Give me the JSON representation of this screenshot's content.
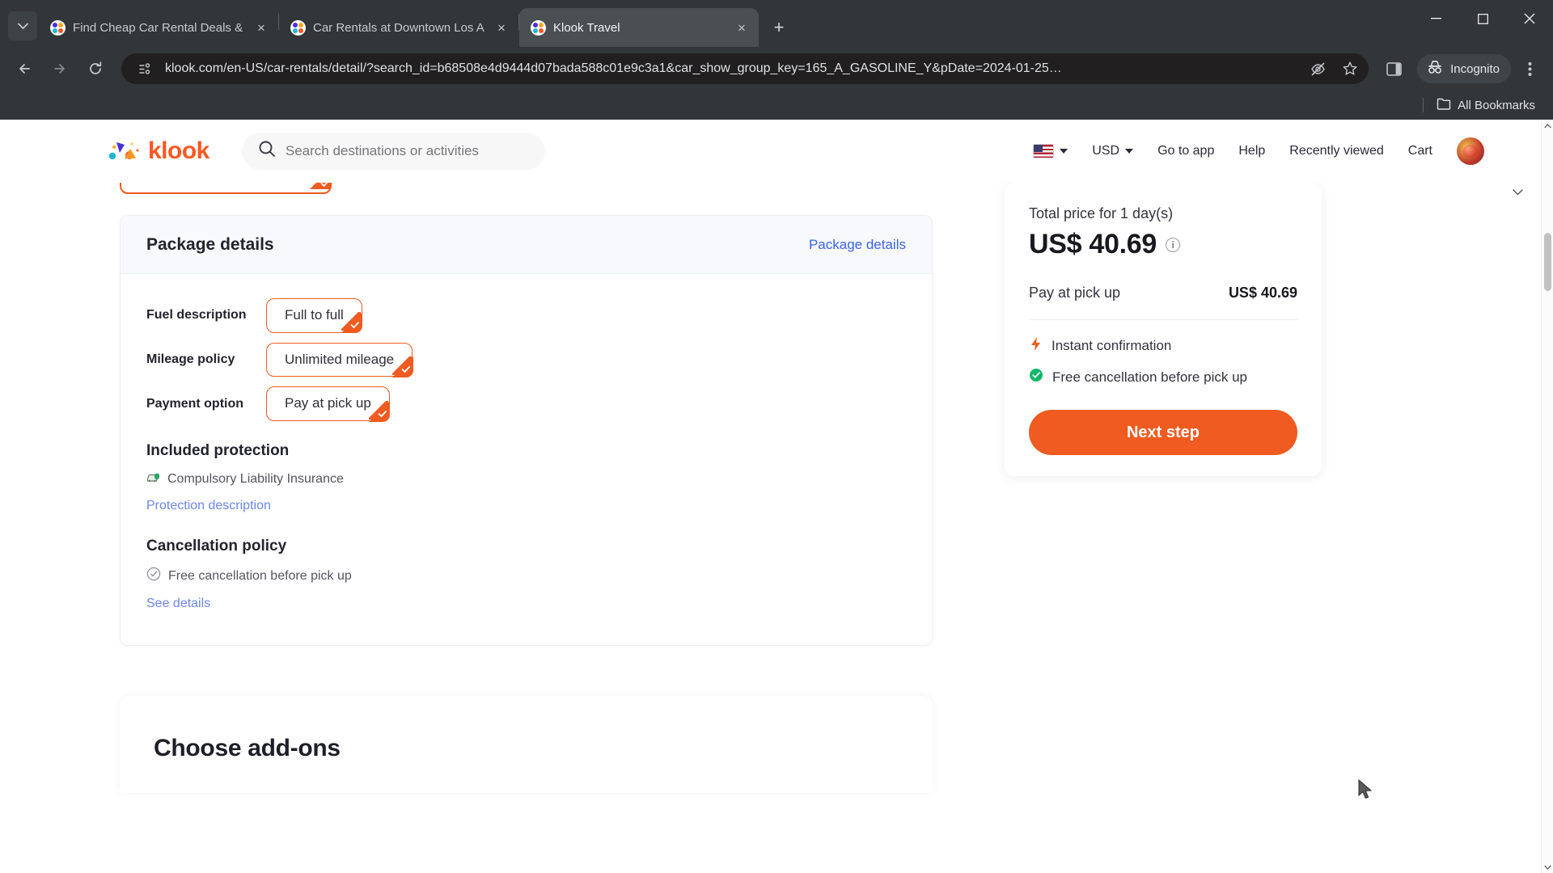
{
  "browser": {
    "tabs": [
      {
        "title": "Find Cheap Car Rental Deals &",
        "favicon": "klook-favicon",
        "active": false
      },
      {
        "title": "Car Rentals at Downtown Los A",
        "favicon": "klook-favicon",
        "active": false
      },
      {
        "title": "Klook Travel",
        "favicon": "klook-favicon",
        "active": true
      }
    ],
    "tab_close_label": "×",
    "new_tab_label": "+",
    "tab_search_icon": "chevron-down-icon",
    "window": {
      "minimize": "−",
      "maximize": "□",
      "close": "✕"
    },
    "nav": {
      "back": "←",
      "forward": "→",
      "reload": "⟳"
    },
    "omnibox": {
      "site_info_icon": "site-settings-icon",
      "url": "klook.com/en-US/car-rentals/detail/?search_id=b68508e4d9444d07bada588c01e9c3a1&car_show_group_key=165_A_GASOLINE_Y&pDate=2024-01-25…",
      "tracking_icon": "eye-slash-icon",
      "bookmark_icon": "star-icon"
    },
    "side_panel_icon": "side-panel-icon",
    "incognito_label": "Incognito",
    "incognito_icon": "incognito-hat-icon",
    "menu_icon": "three-dot-menu-icon",
    "bookmarks": {
      "label": "All Bookmarks",
      "icon": "folder-icon"
    }
  },
  "site": {
    "header": {
      "logo_text": "klook",
      "search_placeholder": "Search destinations or activities",
      "search_icon": "search-icon",
      "language": {
        "flag": "us-flag-icon",
        "caret": "chevron-down-icon"
      },
      "currency": "USD",
      "nav_items": [
        "Go to app",
        "Help",
        "Recently viewed",
        "Cart"
      ],
      "avatar": "user-avatar"
    },
    "package_card": {
      "title": "Package details",
      "details_link": "Package details",
      "options": [
        {
          "label": "Fuel description",
          "value": "Full to full",
          "selected": true
        },
        {
          "label": "Mileage policy",
          "value": "Unlimited mileage",
          "selected": true
        },
        {
          "label": "Payment option",
          "value": "Pay at pick up",
          "selected": true
        }
      ],
      "protection": {
        "title": "Included protection",
        "item": "Compulsory Liability Insurance",
        "item_icon": "car-shield-icon",
        "link": "Protection description"
      },
      "cancellation": {
        "title": "Cancellation policy",
        "item": "Free cancellation before pick up",
        "item_icon": "check-circle-outline-icon",
        "link": "See details"
      }
    },
    "price_card": {
      "total_label": "Total price for 1 day(s)",
      "total_amount": "US$ 40.69",
      "info_icon": "info-icon",
      "pay_label": "Pay at pick up",
      "pay_amount": "US$ 40.69",
      "benefits": [
        {
          "text": "Instant confirmation",
          "icon": "lightning-bolt-icon"
        },
        {
          "text": "Free cancellation before pick up",
          "icon": "check-circle-filled-icon"
        }
      ],
      "cta": "Next step"
    },
    "addons": {
      "title": "Choose add-ons"
    }
  },
  "colors": {
    "brand_orange": "#ef5b20",
    "link_blue": "#3b63f0",
    "success_green": "#12b76a",
    "chrome_bg": "#323639"
  }
}
